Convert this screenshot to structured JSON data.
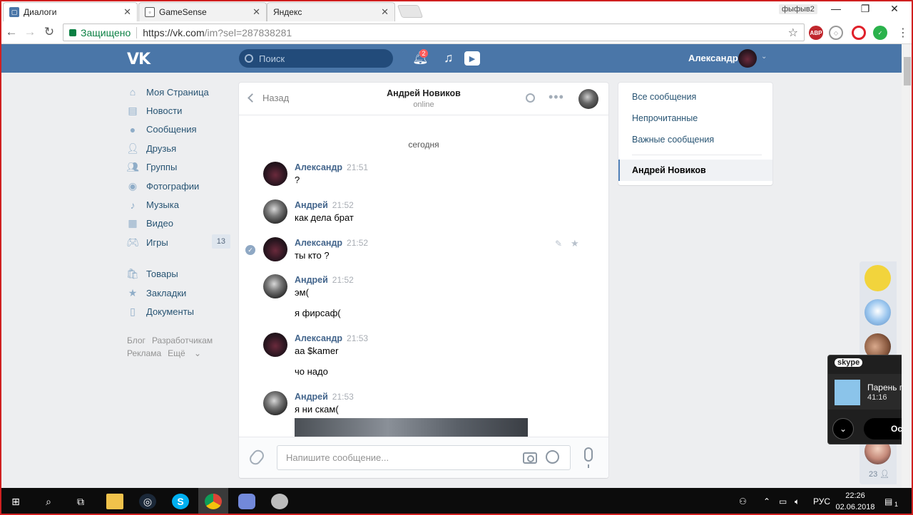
{
  "browser": {
    "tabs": [
      {
        "title": "Диалоги",
        "active": true
      },
      {
        "title": "GameSense",
        "active": false
      },
      {
        "title": "Яндекс",
        "active": false
      }
    ],
    "profile_label": "фыфыв2",
    "secure_label": "Защищено",
    "url_host": "https://vk.com",
    "url_path": "/im?sel=287838281"
  },
  "vk_header": {
    "logo": "VK",
    "search_placeholder": "Поиск",
    "notifications_count": "2",
    "user_name": "Александр"
  },
  "sidebar": {
    "items": [
      {
        "label": "Моя Страница",
        "icon": "home-icon"
      },
      {
        "label": "Новости",
        "icon": "news-icon"
      },
      {
        "label": "Сообщения",
        "icon": "messages-icon"
      },
      {
        "label": "Друзья",
        "icon": "friends-icon"
      },
      {
        "label": "Группы",
        "icon": "groups-icon"
      },
      {
        "label": "Фотографии",
        "icon": "photos-icon"
      },
      {
        "label": "Музыка",
        "icon": "music-icon"
      },
      {
        "label": "Видео",
        "icon": "video-icon"
      },
      {
        "label": "Игры",
        "icon": "games-icon",
        "count": "13"
      }
    ],
    "items2": [
      {
        "label": "Товары",
        "icon": "market-icon"
      },
      {
        "label": "Закладки",
        "icon": "bookmarks-icon"
      },
      {
        "label": "Документы",
        "icon": "documents-icon"
      }
    ],
    "footer": {
      "blog": "Блог",
      "developers": "Разработчикам",
      "ads": "Реклама",
      "more": "Ещё"
    }
  },
  "chat": {
    "back_label": "Назад",
    "contact_name": "Андрей Новиков",
    "contact_status": "online",
    "day_separator": "сегодня",
    "messages": [
      {
        "author": "Александр",
        "time": "21:51",
        "lines": [
          "?"
        ]
      },
      {
        "author": "Андрей",
        "time": "21:52",
        "lines": [
          "как дела брат"
        ]
      },
      {
        "author": "Александр",
        "time": "21:52",
        "lines": [
          "ты кто ?"
        ]
      },
      {
        "author": "Андрей",
        "time": "21:52",
        "lines": [
          "эм(",
          "я фирсаф("
        ]
      },
      {
        "author": "Александр",
        "time": "21:53",
        "lines": [
          "аа $kamer",
          "чо надо"
        ]
      },
      {
        "author": "Андрей",
        "time": "21:53",
        "lines": [
          "я ни скам("
        ]
      }
    ],
    "input_placeholder": "Напишите сообщение..."
  },
  "filters": {
    "all": "Все сообщения",
    "unread": "Непрочитанные",
    "important": "Важные сообщения",
    "selected": "Андрей Новиков"
  },
  "rail": {
    "count": "23"
  },
  "skype": {
    "logo": "skype",
    "caller": "Парень под",
    "duration": "41:16",
    "stop_label": "Оста"
  },
  "taskbar": {
    "lang": "РУС",
    "time": "22:26",
    "date": "02.06.2018",
    "notif_count": "1"
  },
  "colors": {
    "vk_blue": "#4a76a8",
    "link": "#285473",
    "author": "#42648b"
  }
}
